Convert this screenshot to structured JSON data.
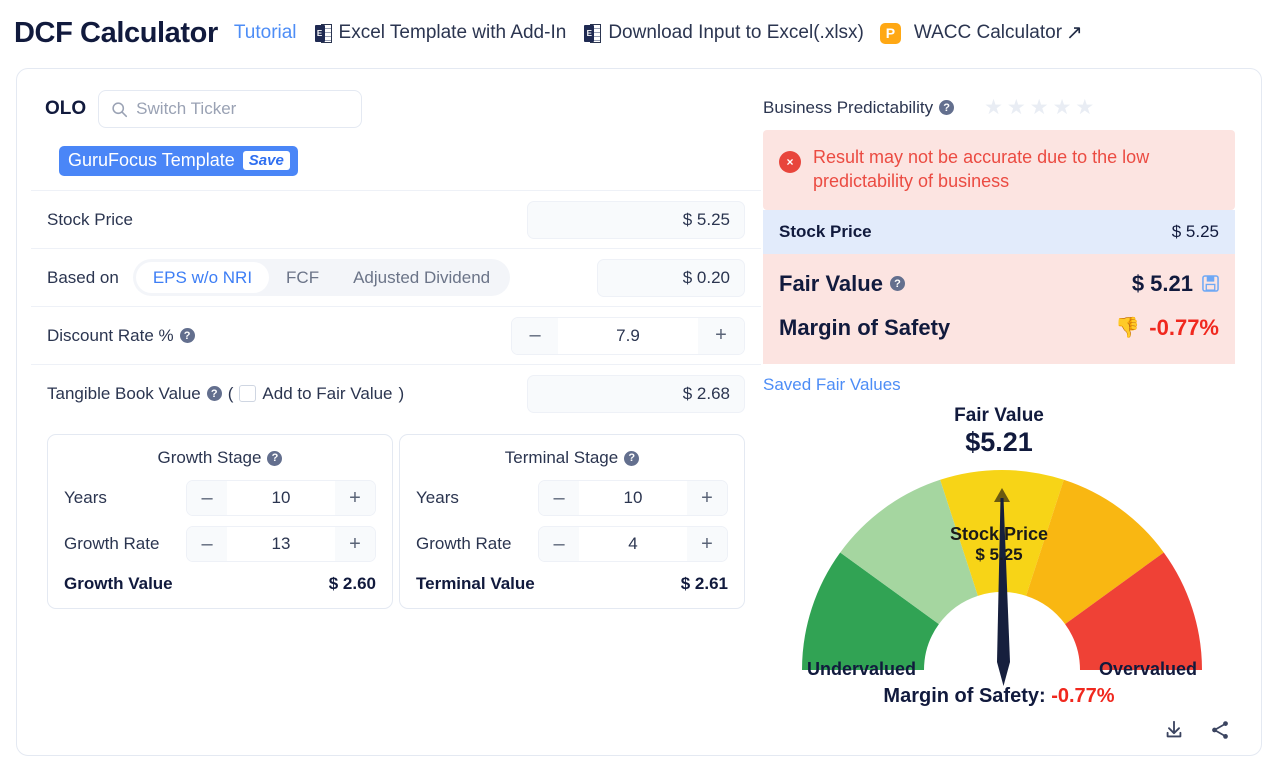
{
  "header": {
    "title": "DCF Calculator",
    "tutorial": "Tutorial",
    "excel_template": "Excel Template with Add-In",
    "excel_icon_letter": "E",
    "download_excel": "Download Input to Excel(.xlsx)",
    "premium_badge": "P",
    "wacc": "WACC Calculator",
    "external_arrow": "↗"
  },
  "ticker": {
    "symbol": "OLO",
    "search_placeholder": "Switch Ticker",
    "search_value": ""
  },
  "template": {
    "name": "GuruFocus Template",
    "save": "Save"
  },
  "form": {
    "stock_price_label": "Stock Price",
    "stock_price_value": "$ 5.25",
    "based_on_label": "Based on",
    "based_on_options": [
      "EPS w/o NRI",
      "FCF",
      "Adjusted Dividend"
    ],
    "based_on_selected": "EPS w/o NRI",
    "based_on_value": "$ 0.20",
    "discount_rate_label": "Discount Rate %",
    "discount_rate_value": "7.9",
    "tangible_book_label": "Tangible Book Value",
    "tangible_book_paren_open": "(",
    "tangible_book_checkbox_label": "Add to Fair Value",
    "tangible_book_paren_close": ")",
    "tangible_book_value": "$ 2.68",
    "minus": "–",
    "plus": "+",
    "help": "?"
  },
  "growth_stage": {
    "title": "Growth Stage",
    "years_label": "Years",
    "years_value": "10",
    "growth_rate_label": "Growth Rate",
    "growth_rate_value": "13",
    "value_label": "Growth Value",
    "value_amount": "$ 2.60"
  },
  "terminal_stage": {
    "title": "Terminal Stage",
    "years_label": "Years",
    "years_value": "10",
    "growth_rate_label": "Growth Rate",
    "growth_rate_value": "4",
    "value_label": "Terminal Value",
    "value_amount": "$ 2.61"
  },
  "predictability": {
    "label": "Business Predictability",
    "stars_total": 5,
    "stars_filled": 0,
    "star_glyph": "★"
  },
  "alert": {
    "icon": "×",
    "message": "Result may not be accurate due to the low predictability of business"
  },
  "results": {
    "stock_price_label": "Stock Price",
    "stock_price_value": "$ 5.25",
    "fair_value_label": "Fair Value",
    "fair_value_value": "$ 5.21",
    "margin_label": "Margin of Safety",
    "margin_value": "-0.77%",
    "saved_link": "Saved Fair Values"
  },
  "chart_data": {
    "type": "gauge",
    "title": "Fair Value",
    "title_value": "$5.21",
    "center_label": "Stock Price",
    "center_value": "$ 5.25",
    "left_label": "Undervalued",
    "right_label": "Overvalued",
    "footer_label": "Margin of Safety:",
    "footer_value": "-0.77%",
    "needle_value": -0.77,
    "needle_angle_deg": 1,
    "segments": [
      {
        "name": "Strongly Undervalued",
        "color": "#31a354",
        "start_deg": 180,
        "end_deg": 144
      },
      {
        "name": "Undervalued",
        "color": "#a5d6a0",
        "start_deg": 144,
        "end_deg": 108
      },
      {
        "name": "Fairly Valued",
        "color": "#f7d417",
        "start_deg": 108,
        "end_deg": 72
      },
      {
        "name": "Overvalued",
        "color": "#f9b712",
        "start_deg": 72,
        "end_deg": 36
      },
      {
        "name": "Strongly Overvalued",
        "color": "#ef4136",
        "start_deg": 36,
        "end_deg": 0
      }
    ],
    "marker": {
      "name": "fair-value-marker",
      "angle_deg": 90,
      "color": "#6b5a10"
    }
  },
  "tools": {
    "download": "download-icon",
    "share": "share-icon"
  },
  "colors": {
    "accent_blue": "#4a86f7",
    "link_blue": "#4d8df6",
    "danger_red": "#f0281e",
    "alert_bg": "#fce4e1",
    "info_bg": "#e2ebfb",
    "premium_orange": "#ffa814"
  }
}
